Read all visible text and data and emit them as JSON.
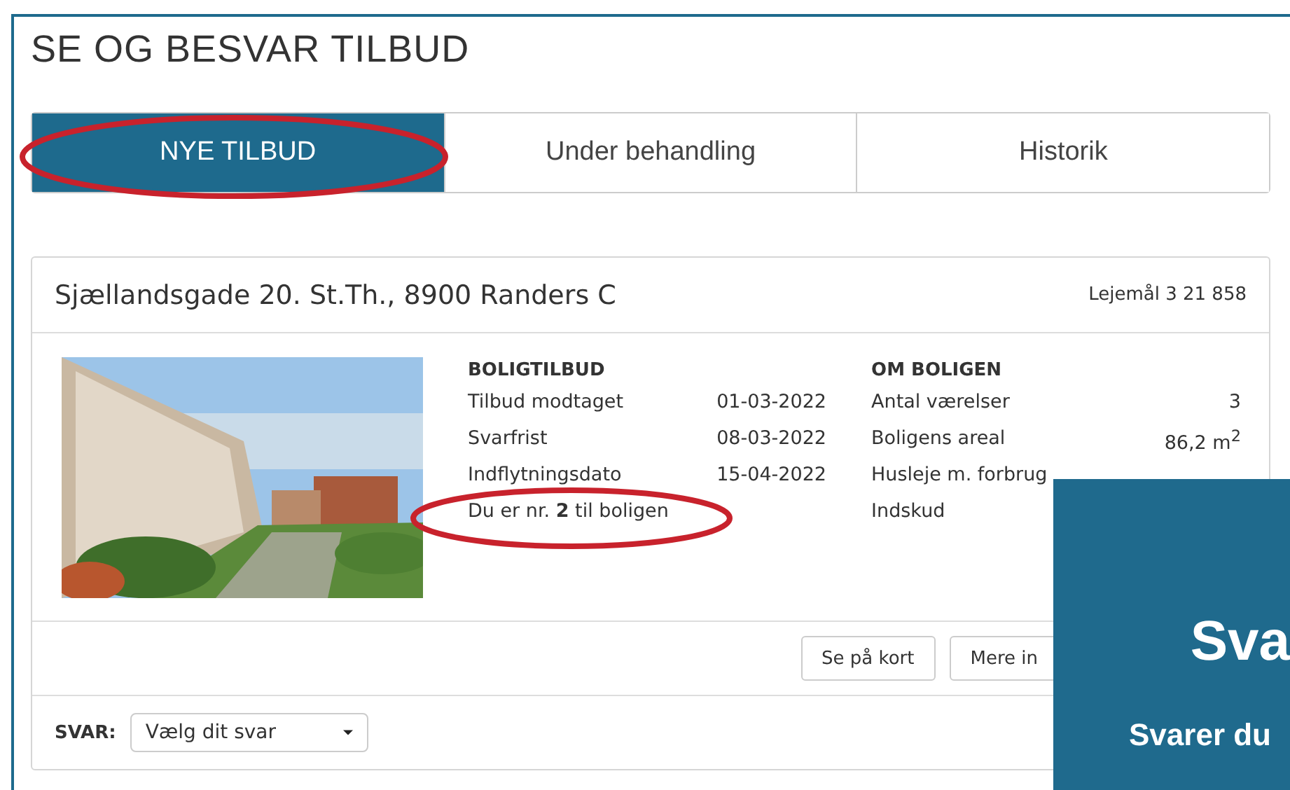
{
  "title": "SE OG BESVAR TILBUD",
  "tabs": [
    {
      "label": "NYE TILBUD",
      "selected": true
    },
    {
      "label": "Under behandling",
      "selected": false
    },
    {
      "label": "Historik",
      "selected": false
    }
  ],
  "offer": {
    "address": "Sjællandsgade 20. St.Th., 8900 Randers C",
    "lease": "Lejemål 3 21 858",
    "image": {
      "kind": "picture"
    },
    "offer_section": {
      "heading": "BOLIGTILBUD",
      "rows": [
        {
          "label": "Tilbud modtaget",
          "value": "01-03-2022"
        },
        {
          "label": "Svarfrist",
          "value": "08-03-2022"
        },
        {
          "label": "Indflytningsdato",
          "value": "15-04-2022"
        },
        {
          "label": "Du er nr. **2** til boligen"
        }
      ]
    },
    "home_section": {
      "heading": "OM BOLIGEN",
      "rows": [
        {
          "label": "Antal værelser",
          "value": "3"
        },
        {
          "label": "Boligens areal",
          "value": "86,2 m$^{2}$"
        },
        {
          "label": "Husleje m. forbrug"
        },
        {
          "label": "Indskud"
        }
      ]
    },
    "buttons": [
      "Se på kort",
      "Mere in"
    ],
    "answer": {
      "label": "SVAR:",
      "placeholder": "Vælg dit svar"
    }
  },
  "overlay": {
    "heading": "Sva",
    "text": "Svarer du"
  }
}
